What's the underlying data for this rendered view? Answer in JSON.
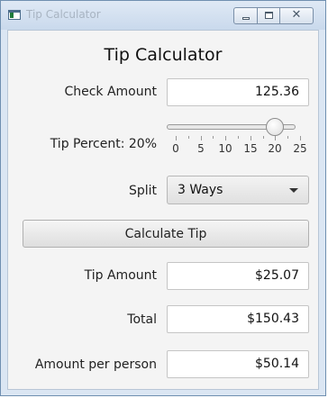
{
  "window": {
    "title": "Tip Calculator",
    "close_glyph": "✕"
  },
  "heading": "Tip Calculator",
  "check": {
    "label": "Check Amount",
    "value": "125.36"
  },
  "tip_percent": {
    "label": "Tip Percent: 20%",
    "value": 20,
    "min": 0,
    "max": 25,
    "ticks": [
      "0",
      "5",
      "10",
      "15",
      "20",
      "25"
    ]
  },
  "split": {
    "label": "Split",
    "selected": "3 Ways"
  },
  "calculate_label": "Calculate Tip",
  "results": {
    "tip_label": "Tip Amount",
    "tip_value": "$25.07",
    "total_label": "Total",
    "total_value": "$150.43",
    "per_person_label": "Amount per person",
    "per_person_value": "$50.14"
  }
}
